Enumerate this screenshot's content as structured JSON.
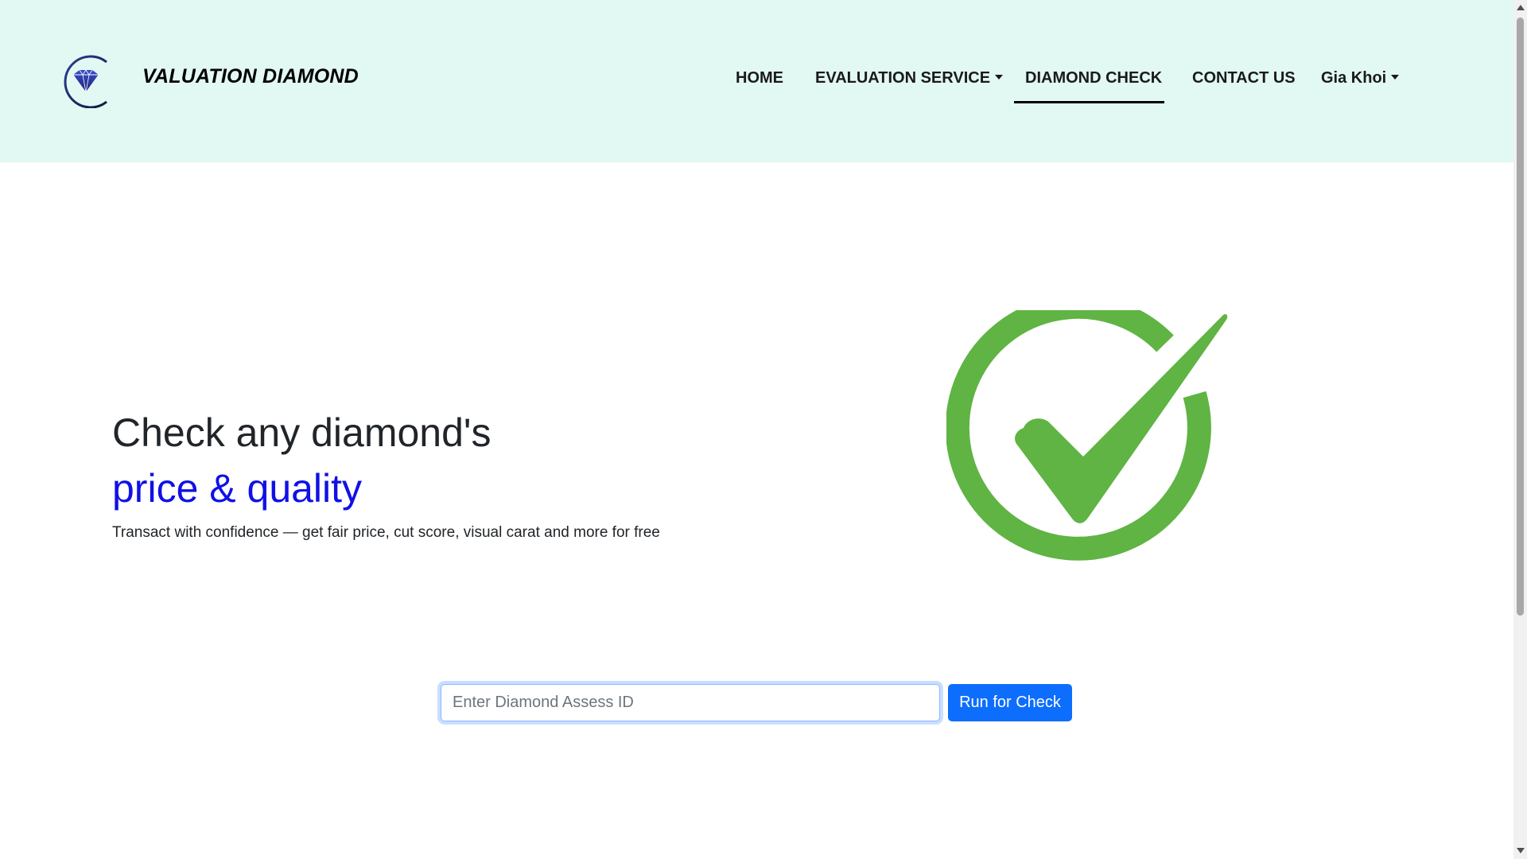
{
  "brand": {
    "name": "VALUATION DIAMOND",
    "logo_icon": "diamond-logo-icon"
  },
  "nav": {
    "home": "HOME",
    "evaluation_service": "EVALUATION SERVICE",
    "diamond_check": "DIAMOND CHECK",
    "contact_us": "CONTACT US",
    "user": "Gia Khoi",
    "active": "DIAMOND CHECK"
  },
  "hero": {
    "title_line1": "Check any diamond's",
    "title_line2": "price & quality",
    "subtitle": "Transact with confidence — get fair price, cut score, visual carat and more for free",
    "graphic_icon": "check-circle-icon"
  },
  "search": {
    "placeholder": "Enter Diamond Assess ID",
    "value": "",
    "button_label": "Run for Check"
  },
  "colors": {
    "header_bg": "#e2f8f3",
    "accent_blue": "#1010e6",
    "button_bg": "#0d6efd",
    "check_green": "#5fb443"
  }
}
